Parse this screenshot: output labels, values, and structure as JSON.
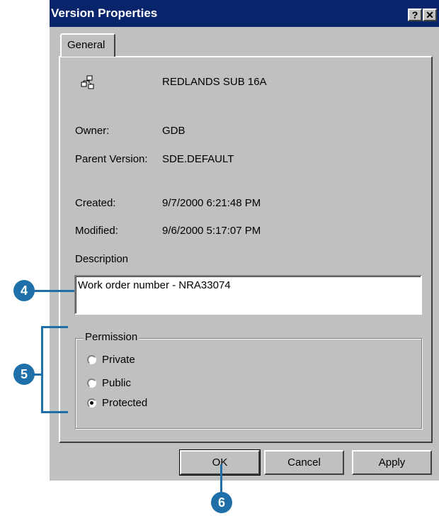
{
  "window": {
    "title": "Version Properties",
    "help_button": "?",
    "close_button": "✕"
  },
  "tabs": [
    "General"
  ],
  "general": {
    "version_icon": "version-tree-icon",
    "version_name": "REDLANDS SUB 16A",
    "owner_label": "Owner:",
    "owner_value": "GDB",
    "parent_label": "Parent Version:",
    "parent_value": "SDE.DEFAULT",
    "created_label": "Created:",
    "created_value": "9/7/2000 6:21:48 PM",
    "modified_label": "Modified:",
    "modified_value": "9/6/2000 5:17:07 PM",
    "description_label": "Description",
    "description_value": "Work order number - NRA33074"
  },
  "permission": {
    "legend": "Permission",
    "options": [
      {
        "label": "Private",
        "checked": false
      },
      {
        "label": "Public",
        "checked": false
      },
      {
        "label": "Protected",
        "checked": true
      }
    ]
  },
  "buttons": {
    "ok": "OK",
    "cancel": "Cancel",
    "apply": "Apply"
  },
  "callouts": {
    "description": "4",
    "permission": "5",
    "ok": "6"
  },
  "colors": {
    "titlebar": "#08246b",
    "callout": "#1f6fa8",
    "dialog": "#c0c0c0"
  }
}
